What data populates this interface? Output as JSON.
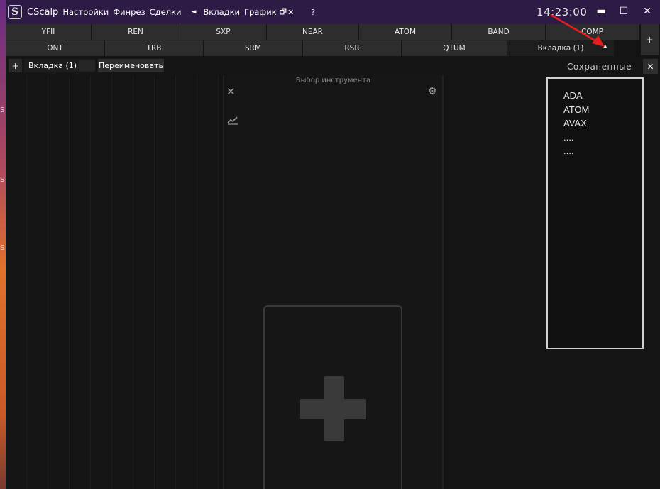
{
  "desktop": {
    "letters": [
      "S",
      "S",
      "S"
    ]
  },
  "titlebar": {
    "logo": "S",
    "app_name": "CScalp",
    "menu": [
      "Настройки",
      "Финрез",
      "Сделки"
    ],
    "prev_arrow": "◄",
    "menu2": [
      "Вкладки",
      "График"
    ],
    "restore_icon": "🗗",
    "close_small": "✕",
    "help": "?",
    "clock": "14:23:00",
    "minimize": "▬",
    "maximize": "☐",
    "close": "✕"
  },
  "instruments": {
    "row1": [
      "YFII",
      "REN",
      "SXP",
      "NEAR",
      "ATOM",
      "BAND",
      "COMP"
    ],
    "row2": [
      "ONT",
      "TRB",
      "SRM",
      "RSR",
      "QTUM",
      "Вкладка (1)"
    ],
    "active_tab": "Вкладка (1)",
    "add": "+",
    "collapse": "▲"
  },
  "toolbar": {
    "add": "+",
    "tab_name": "Вкладка (1)",
    "rename": "Переименовать",
    "saved_label": "Сохраненные",
    "close": "✕"
  },
  "instrument_panel": {
    "title": "Выбор инструмента",
    "close": "✕",
    "gear": "⚙"
  },
  "saved_list": [
    "ADA",
    "ATOM",
    "AVAX",
    "....",
    "...."
  ],
  "colors": {
    "titlebar": "#2d1a45",
    "cell": "#2d2d2d",
    "arrow": "#e41e1e"
  }
}
